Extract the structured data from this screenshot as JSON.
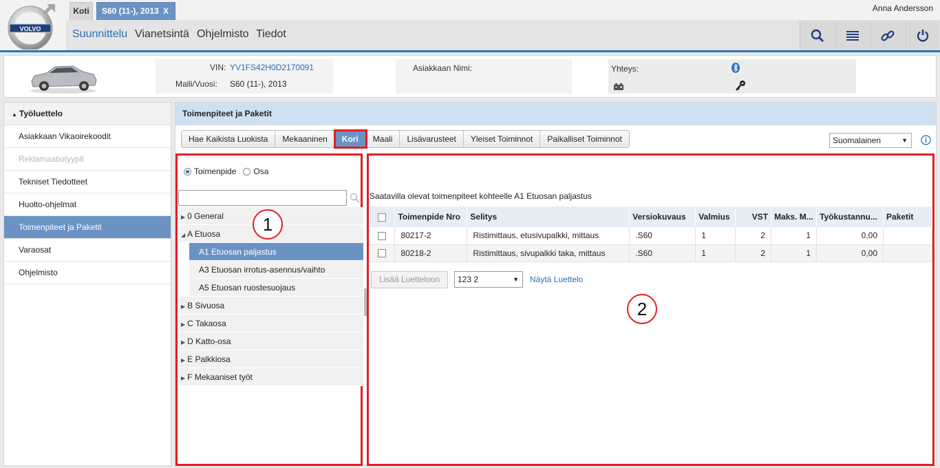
{
  "header": {
    "tabs": [
      {
        "label": "Koti"
      },
      {
        "label": "S60 (11-), 2013",
        "close": "X"
      }
    ],
    "user": "Anna Andersson",
    "nav": [
      "Suunnittelu",
      "Vianetsintä",
      "Ohjelmisto",
      "Tiedot"
    ],
    "toolbar_icons": [
      "search-icon",
      "list-icon",
      "link-icon",
      "power-icon"
    ],
    "accent_color": "#2e74b5"
  },
  "vehicle": {
    "vin_label": "VIN:",
    "vin": "YV1FS42H0D2170091",
    "model_label": "Malli/Vuosi:",
    "model": "S60 (11-), 2013",
    "customer_label": "Asiakkaan Nimi:",
    "connection_label": "Yhteys:"
  },
  "sidebar": {
    "title": "Työluettelo",
    "items": [
      {
        "label": "Asiakkaan Vikaoirekoodit",
        "state": "normal"
      },
      {
        "label": "Reklamaatiotyypit",
        "state": "disabled"
      },
      {
        "label": "Tekniset Tiedotteet",
        "state": "normal"
      },
      {
        "label": "Huolto-ohjelmat",
        "state": "normal"
      },
      {
        "label": "Toimenpiteet ja Paketit",
        "state": "active"
      },
      {
        "label": "Varaosat",
        "state": "normal"
      },
      {
        "label": "Ohjelmisto",
        "state": "normal"
      }
    ]
  },
  "main": {
    "title": "Toimenpiteet ja Paketit",
    "category_tabs": [
      "Hae Kaikista Luokista",
      "Mekaaninen",
      "Kori",
      "Maali",
      "Lisävarusteet",
      "Yleiset Toiminnot",
      "Paikalliset Toiminnot"
    ],
    "active_tab": "Kori",
    "language": "Suomalainen",
    "radio": {
      "option1": "Toimenpide",
      "option2": "Osa",
      "selected": "Toimenpide"
    },
    "search_value": "",
    "tree": [
      {
        "label": "0 General",
        "expanded": false
      },
      {
        "label": "A Etuosa",
        "expanded": true,
        "children": [
          {
            "label": "A1 Etuosan paljastus",
            "selected": true
          },
          {
            "label": "A3 Etuosan irrotus-asennus/vaihto",
            "selected": false
          },
          {
            "label": "A5 Etuosan ruostesuojaus",
            "selected": false
          }
        ]
      },
      {
        "label": "B Sivuosa",
        "expanded": false
      },
      {
        "label": "C Takaosa",
        "expanded": false
      },
      {
        "label": "D Katto-osa",
        "expanded": false
      },
      {
        "label": "E Palkkiosa",
        "expanded": false
      },
      {
        "label": "F Mekaaniset työt",
        "expanded": false
      }
    ],
    "result_caption": "Saatavilla olevat toimenpiteet kohteelle A1 Etuosan paljastus",
    "table": {
      "columns": [
        "Toimenpide Nro",
        "Selitys",
        "Versiokuvaus",
        "Valmius",
        "VST",
        "Maks. M...",
        "Työkustannu...",
        "Paketit"
      ],
      "rows": [
        {
          "nro": "80217-2",
          "selitys": "Ristimittaus, etusivupalkki, mittaus",
          "versio": ".S60",
          "valmius": "1",
          "vst": "2",
          "maks": "1",
          "tyokustannus": "0,00",
          "paketit": ""
        },
        {
          "nro": "80218-2",
          "selitys": "Ristimittaus, sivupalkki taka, mittaus",
          "versio": ".S60",
          "valmius": "1",
          "vst": "2",
          "maks": "1",
          "tyokustannus": "0,00",
          "paketit": ""
        }
      ]
    },
    "add_button": "Lisää Luetteloon",
    "list_select": "123 2",
    "show_list": "Näytä Luettelo"
  },
  "callouts": [
    "1",
    "2"
  ]
}
